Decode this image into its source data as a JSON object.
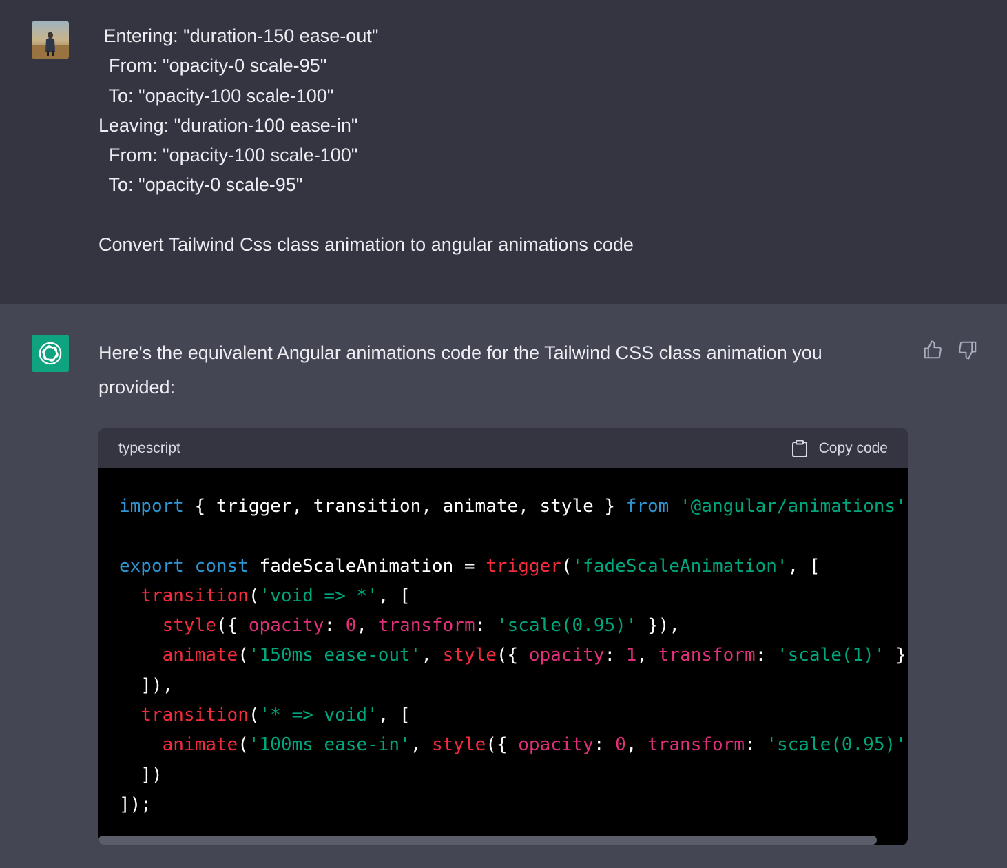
{
  "user_message": {
    "lines": [
      " Entering: \"duration-150 ease-out\"",
      "  From: \"opacity-0 scale-95\"",
      "  To: \"opacity-100 scale-100\"",
      "Leaving: \"duration-100 ease-in\"",
      "  From: \"opacity-100 scale-100\"",
      "  To: \"opacity-0 scale-95\"",
      "",
      "Convert Tailwind Css class animation to angular animations code"
    ]
  },
  "assistant_message": {
    "intro": "Here's the equivalent Angular animations code for the Tailwind CSS class animation you provided:",
    "code_block": {
      "language": "typescript",
      "copy_label": "Copy code",
      "lines": [
        [
          [
            "kw",
            "import"
          ],
          [
            "p",
            " { trigger, transition, animate, style } "
          ],
          [
            "kw",
            "from"
          ],
          [
            "p",
            " "
          ],
          [
            "str",
            "'@angular/animations'"
          ],
          [
            "p",
            ";"
          ]
        ],
        [],
        [
          [
            "kw",
            "export"
          ],
          [
            "p",
            " "
          ],
          [
            "kw",
            "const"
          ],
          [
            "p",
            " fadeScaleAnimation = "
          ],
          [
            "fn",
            "trigger"
          ],
          [
            "p",
            "("
          ],
          [
            "str",
            "'fadeScaleAnimation'"
          ],
          [
            "p",
            ", ["
          ]
        ],
        [
          [
            "p",
            "  "
          ],
          [
            "fn",
            "transition"
          ],
          [
            "p",
            "("
          ],
          [
            "str",
            "'void => *'"
          ],
          [
            "p",
            ", ["
          ]
        ],
        [
          [
            "p",
            "    "
          ],
          [
            "fn",
            "style"
          ],
          [
            "p",
            "({ "
          ],
          [
            "pr",
            "opacity"
          ],
          [
            "p",
            ": "
          ],
          [
            "num",
            "0"
          ],
          [
            "p",
            ", "
          ],
          [
            "pr",
            "transform"
          ],
          [
            "p",
            ": "
          ],
          [
            "str",
            "'scale(0.95)'"
          ],
          [
            "p",
            " }),"
          ]
        ],
        [
          [
            "p",
            "    "
          ],
          [
            "fn",
            "animate"
          ],
          [
            "p",
            "("
          ],
          [
            "str",
            "'150ms ease-out'"
          ],
          [
            "p",
            ", "
          ],
          [
            "fn",
            "style"
          ],
          [
            "p",
            "({ "
          ],
          [
            "pr",
            "opacity"
          ],
          [
            "p",
            ": "
          ],
          [
            "num",
            "1"
          ],
          [
            "p",
            ", "
          ],
          [
            "pr",
            "transform"
          ],
          [
            "p",
            ": "
          ],
          [
            "str",
            "'scale(1)'"
          ],
          [
            "p",
            " }))"
          ]
        ],
        [
          [
            "p",
            "  ]),"
          ]
        ],
        [
          [
            "p",
            "  "
          ],
          [
            "fn",
            "transition"
          ],
          [
            "p",
            "("
          ],
          [
            "str",
            "'* => void'"
          ],
          [
            "p",
            ", ["
          ]
        ],
        [
          [
            "p",
            "    "
          ],
          [
            "fn",
            "animate"
          ],
          [
            "p",
            "("
          ],
          [
            "str",
            "'100ms ease-in'"
          ],
          [
            "p",
            ", "
          ],
          [
            "fn",
            "style"
          ],
          [
            "p",
            "({ "
          ],
          [
            "pr",
            "opacity"
          ],
          [
            "p",
            ": "
          ],
          [
            "num",
            "0"
          ],
          [
            "p",
            ", "
          ],
          [
            "pr",
            "transform"
          ],
          [
            "p",
            ": "
          ],
          [
            "str",
            "'scale(0.95)'"
          ],
          [
            "p",
            " }))"
          ]
        ],
        [
          [
            "p",
            "  ])"
          ]
        ],
        [
          [
            "p",
            "]);"
          ]
        ]
      ]
    }
  },
  "icons": {
    "user_avatar": "user-avatar-photo",
    "bot_avatar": "openai-logo-icon",
    "thumbs_up": "thumbs-up-icon",
    "thumbs_down": "thumbs-down-icon",
    "copy": "clipboard-icon"
  },
  "colors": {
    "user_bg": "#343541",
    "assistant_bg": "#444654",
    "bot_avatar_bg": "#10a37f",
    "code_bg": "#000000",
    "code_header_bg": "#343541",
    "keyword": "#2e95d3",
    "function": "#f22c3d",
    "string": "#00a67d",
    "number": "#df3079"
  }
}
